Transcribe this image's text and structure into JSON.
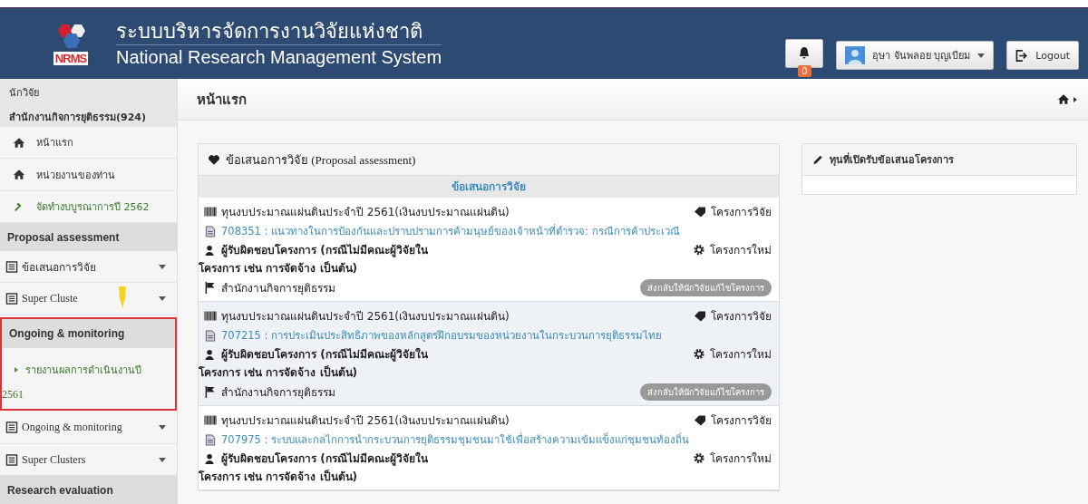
{
  "header": {
    "title_th": "ระบบบริหารจัดการงานวิจัยแห่งชาติ",
    "title_en": "National Research Management System",
    "logo_text": "NRMS",
    "notifications": {
      "count": "0"
    },
    "user": {
      "name": "อุษา จันพลอย บุญเบียม"
    },
    "logout": "Logout"
  },
  "sidebar": {
    "role": "นักวิจัย",
    "org": "สำนักงานกิจการยุติธรรม(924)",
    "items": [
      {
        "kind": "home",
        "label": "หน้าแรก"
      },
      {
        "kind": "home",
        "label": "หน่วยงานของท่าน"
      },
      {
        "kind": "tool",
        "label": "จัดทำงบบูรณาการปี 2562"
      },
      {
        "kind": "section",
        "label": "Proposal assessment"
      },
      {
        "kind": "dropdown",
        "label": "ข้อเสนอการวิจัย",
        "pin": false
      },
      {
        "kind": "dropdown",
        "label": "Super Cluste",
        "pin": true
      },
      {
        "kind": "group",
        "highlighted": true,
        "label": "Ongoing & monitoring",
        "link": "รายงานผลการดำเนินงานปี",
        "link_cont": "2561"
      },
      {
        "kind": "dropdown",
        "label": "Ongoing & monitoring",
        "pin": false
      },
      {
        "kind": "dropdown",
        "label": "Super Clusters",
        "pin": false
      },
      {
        "kind": "section",
        "label": "Research evaluation"
      }
    ]
  },
  "breadcrumb": {
    "title": "หน้าแรก"
  },
  "proposals": {
    "title": "ข้อเสนอการวิจัย (Proposal assessment)",
    "subheading": "ข้อเสนอการวิจัย",
    "items": [
      {
        "highlighted": false,
        "fund": "ทุนงบประมาณแผ่นดินประจำปี 2561(เงินงบประมาณแผ่นดิน)",
        "type": "โครงการวิจัย",
        "link": "708351 : แนวทางในการป้องกันและปราบปรามการค้ามนุษย์ของเจ้าหน้าที่ตำรวจ: กรณีการค้าประเวณี",
        "responsible": "ผู้รับผิดชอบโครงการ (กรณีไม่มีคณะผู้วิจัยใน",
        "responsible_cont": "โครงการ เช่น การจัดจ้าง เป็นต้น)",
        "status": "โครงการใหม่",
        "org": "สำนักงานกิจการยุติธรรม",
        "badge": "ส่งกลับให้นักวิจัยแก้ไขโครงการ"
      },
      {
        "highlighted": true,
        "fund": "ทุนงบประมาณแผ่นดินประจำปี 2561(เงินงบประมาณแผ่นดิน)",
        "type": "โครงการวิจัย",
        "link": "707215 : การประเมินประสิทธิภาพของหลักสูตรฝึกอบรมของหน่วยงานในกระบวนการยุติธรรมไทย",
        "responsible": "ผู้รับผิดชอบโครงการ (กรณีไม่มีคณะผู้วิจัยใน",
        "responsible_cont": "โครงการ เช่น การจัดจ้าง เป็นต้น)",
        "status": "โครงการใหม่",
        "org": "สำนักงานกิจการยุติธรรม",
        "badge": "ส่งกลับให้นักวิจัยแก้ไขโครงการ"
      },
      {
        "highlighted": false,
        "fund": "ทุนงบประมาณแผ่นดินประจำปี 2561(เงินงบประมาณแผ่นดิน)",
        "type": "โครงการวิจัย",
        "link": "707975 : ระบบและกลไกการนำกระบวนการยุติธรรมชุมชนมาใช้เพื่อสร้างความเข้มแข็งแก่ชุมชนท้องถิ่น",
        "responsible": "ผู้รับผิดชอบโครงการ (กรณีไม่มีคณะผู้วิจัยใน",
        "responsible_cont": "โครงการ เช่น การจัดจ้าง เป็นต้น)",
        "status": "โครงการใหม่"
      }
    ]
  },
  "funds_panel": {
    "title": "ทุนที่เปิดรับข้อเสนอโครงการ"
  }
}
